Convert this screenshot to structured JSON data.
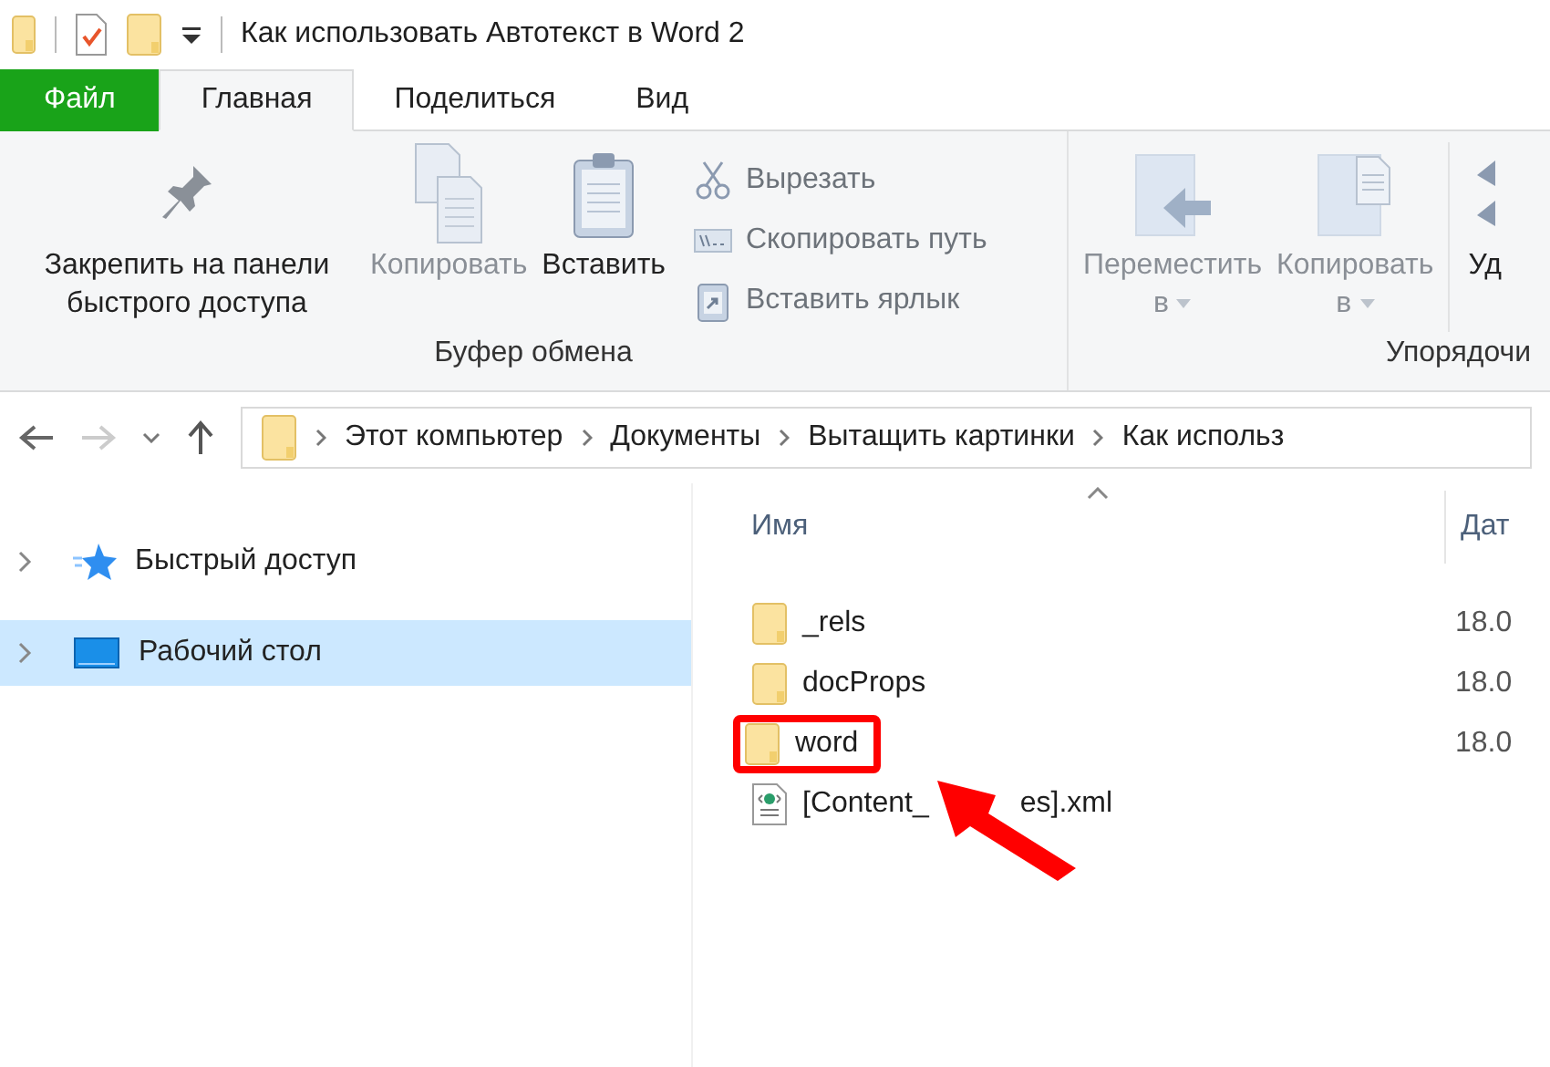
{
  "title_bar": {
    "title": "Как использовать Автотекст в Word 2"
  },
  "ribbon_tabs": [
    {
      "label": "Файл",
      "kind": "file",
      "selected": false
    },
    {
      "label": "Главная",
      "kind": "tab",
      "selected": true
    },
    {
      "label": "Поделиться",
      "kind": "tab",
      "selected": false
    },
    {
      "label": "Вид",
      "kind": "tab",
      "selected": false
    }
  ],
  "ribbon_groups": [
    {
      "label": "Буфер обмена",
      "items": [
        {
          "kind": "large",
          "label": "Закрепить на панели быстрого доступа",
          "disabled": false
        },
        {
          "kind": "large",
          "label": "Копировать",
          "disabled": true
        },
        {
          "kind": "large",
          "label": "Вставить",
          "disabled": false
        },
        {
          "kind": "small",
          "labels": [
            "Вырезать",
            "Скопировать путь",
            "Вставить ярлык"
          ],
          "disabled": true
        }
      ]
    },
    {
      "label": "Упорядочи",
      "items": [
        {
          "kind": "large",
          "label": "Переместить",
          "sub": "в",
          "disabled": true
        },
        {
          "kind": "large",
          "label": "Копировать",
          "sub": "в",
          "disabled": true
        },
        {
          "kind": "large",
          "label": "Уд",
          "disabled": false
        }
      ]
    }
  ],
  "address_bar": {
    "back_disabled": false,
    "forward_disabled": true,
    "breadcrumbs": [
      "Этот компьютер",
      "Документы",
      "Вытащить картинки",
      "Как использ"
    ]
  },
  "nav_tree": [
    {
      "label": "Быстрый доступ",
      "selected": false
    },
    {
      "label": "Рабочий стол",
      "selected": true
    }
  ],
  "file_list": {
    "columns": [
      "Имя",
      "Дат"
    ],
    "rows": [
      {
        "name": "_rels",
        "kind": "folder",
        "column_2": "18.0",
        "highlighted": false
      },
      {
        "name": "docProps",
        "kind": "folder",
        "column_2": "18.0",
        "highlighted": false
      },
      {
        "name": "word",
        "kind": "folder",
        "column_2": "18.0",
        "highlighted": true
      },
      {
        "name_parts": [
          "[Content_",
          "es].xml"
        ],
        "kind": "xml",
        "highlighted": false
      }
    ]
  }
}
